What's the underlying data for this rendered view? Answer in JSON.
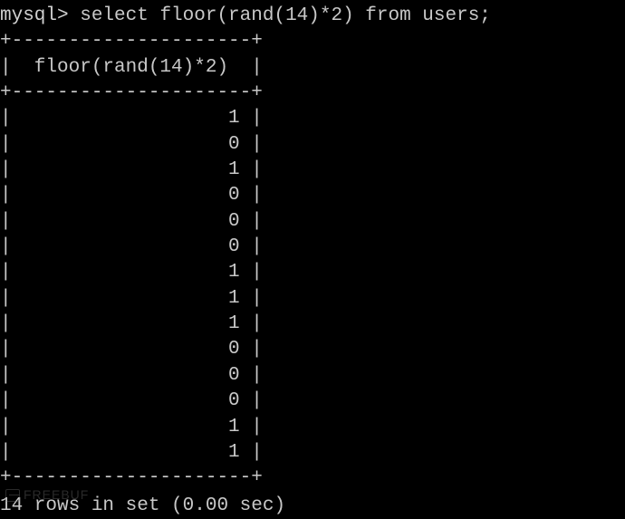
{
  "prompt": "mysql>",
  "query": " select floor(rand(14)*2) from users;",
  "table": {
    "border": "+---------------------+",
    "header_row": "|  floor(rand(14)*2)  |",
    "column_header": "floor(rand(14)*2)",
    "rows": [
      1,
      0,
      1,
      0,
      0,
      0,
      1,
      1,
      1,
      0,
      0,
      0,
      1,
      1
    ]
  },
  "status": "14 rows in set (0.00 sec)",
  "watermark": "FREEBUF"
}
